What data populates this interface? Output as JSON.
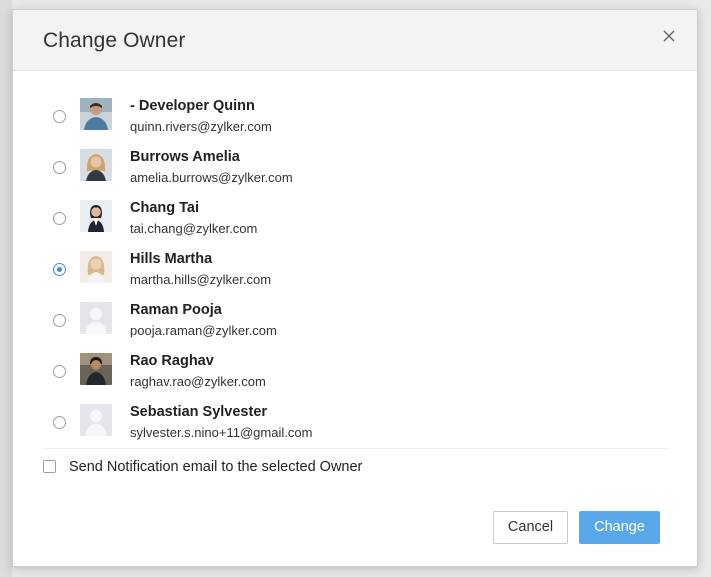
{
  "dialog": {
    "title": "Change Owner",
    "close_icon": "close-icon"
  },
  "owners": [
    {
      "name": "- Developer Quinn",
      "email": "quinn.rivers@zylker.com",
      "selected": false,
      "avatar": "photo"
    },
    {
      "name": "Burrows Amelia",
      "email": "amelia.burrows@zylker.com",
      "selected": false,
      "avatar": "photo"
    },
    {
      "name": "Chang Tai",
      "email": "tai.chang@zylker.com",
      "selected": false,
      "avatar": "photo"
    },
    {
      "name": "Hills Martha",
      "email": "martha.hills@zylker.com",
      "selected": true,
      "avatar": "photo"
    },
    {
      "name": "Raman Pooja",
      "email": "pooja.raman@zylker.com",
      "selected": false,
      "avatar": "placeholder"
    },
    {
      "name": "Rao Raghav",
      "email": "raghav.rao@zylker.com",
      "selected": false,
      "avatar": "photo"
    },
    {
      "name": "Sebastian Sylvester",
      "email": "sylvester.s.nino+11@gmail.com",
      "selected": false,
      "avatar": "placeholder"
    }
  ],
  "notification": {
    "label": "Send Notification email to the selected Owner",
    "checked": false
  },
  "buttons": {
    "cancel_label": "Cancel",
    "change_label": "Change"
  },
  "colors": {
    "accent": "#5aa8ea",
    "radio_selected": "#3a8ddf"
  }
}
